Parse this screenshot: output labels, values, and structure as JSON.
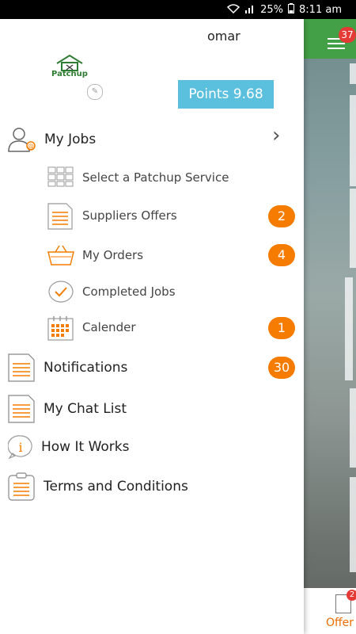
{
  "status": {
    "battery": "25%",
    "time": "8:11 am"
  },
  "drawer": {
    "username": "omar",
    "logo_text": "Patchup",
    "points_label": "Points 9.68",
    "my_jobs": {
      "label": "My Jobs"
    },
    "sub_items": [
      {
        "label": "Select a Patchup Service",
        "badge": ""
      },
      {
        "label": "Suppliers Offers",
        "badge": "2"
      },
      {
        "label": "My Orders",
        "badge": "4"
      },
      {
        "label": "Completed Jobs",
        "badge": ""
      },
      {
        "label": "Calender",
        "badge": "1"
      }
    ],
    "main_items": [
      {
        "label": "Notifications",
        "badge": "30"
      },
      {
        "label": "My Chat List"
      },
      {
        "label": "How It Works"
      },
      {
        "label": "Terms and Conditions"
      }
    ]
  },
  "background": {
    "header_badge": "37",
    "tab_label": "Offer",
    "tab_badge": "2"
  },
  "colors": {
    "accent": "#f57c00",
    "points_bg": "#5bc0de",
    "header_green": "#43a047",
    "badge_red": "#e53935"
  }
}
